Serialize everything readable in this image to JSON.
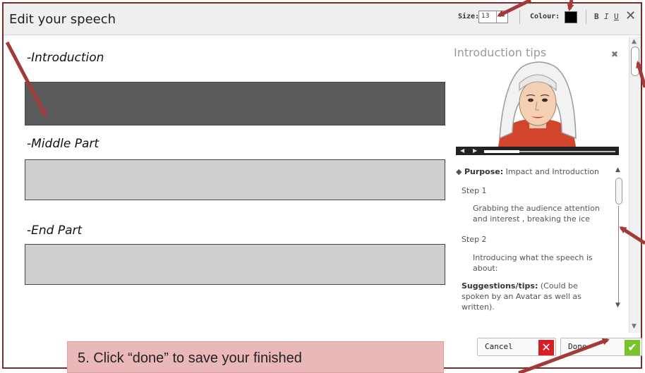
{
  "window": {
    "title": "Edit your speech"
  },
  "toolbar": {
    "size_label": "Size:",
    "size_value": "13",
    "colour_label": "Colour:",
    "colour_value": "#000000",
    "bold_label": "B",
    "italic_label": "I",
    "underline_label": "U",
    "close_icon": "close-icon"
  },
  "editor": {
    "sections": [
      {
        "label": "-Introduction",
        "fill": "#5a5a5a"
      },
      {
        "label": "-Middle Part",
        "fill": "#cfcfcf"
      },
      {
        "label": "-End Part",
        "fill": "#cfcfcf"
      }
    ]
  },
  "tips": {
    "title": "Introduction tips",
    "purpose_label": "Purpose:",
    "purpose_text": "Impact and Introduction",
    "step1_label": "Step 1",
    "step1_text_1": "Grabbing the audience attention",
    "step1_text_2": "and interest , breaking the ice",
    "step2_label": "Step 2",
    "step2_text_1": "Introducing what the speech is",
    "step2_text_2": "about:",
    "suggest_label": "Suggestions/tips:",
    "suggest_text_1": "(Could be",
    "suggest_text_2": "spoken by an Avatar as well as",
    "suggest_text_3": "written)."
  },
  "buttons": {
    "cancel_label": "Cancel",
    "done_label": "Done",
    "cancel_color": "#d61f26",
    "done_color": "#78c22a"
  },
  "callout": {
    "text": "5. Click “done” to save your finished"
  },
  "colors": {
    "frame": "#7b2b2b",
    "arrow": "#a33a3a",
    "callout_bg": "#eab8b8"
  }
}
